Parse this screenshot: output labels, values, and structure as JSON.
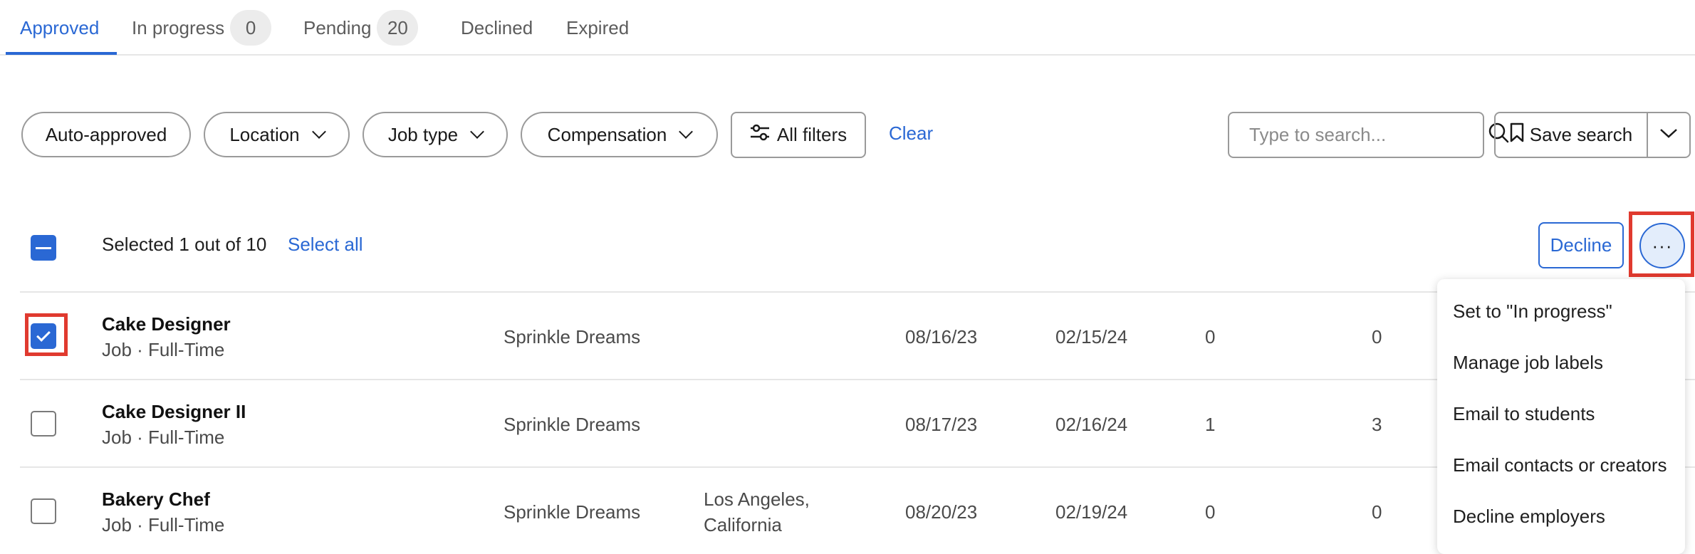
{
  "tabs": [
    {
      "label": "Approved"
    },
    {
      "label": "In progress",
      "count": "0"
    },
    {
      "label": "Pending",
      "count": "20"
    },
    {
      "label": "Declined"
    },
    {
      "label": "Expired"
    }
  ],
  "filters": {
    "auto_approved": "Auto-approved",
    "location": "Location",
    "job_type": "Job type",
    "compensation": "Compensation",
    "all_filters": "All filters",
    "clear": "Clear"
  },
  "search": {
    "placeholder": "Type to search..."
  },
  "save_search": {
    "label": "Save search"
  },
  "selection": {
    "text": "Selected 1 out of 10",
    "select_all": "Select all",
    "decline": "Decline",
    "more": "···"
  },
  "rows": [
    {
      "title": "Cake Designer",
      "subtitle": "Job · Full-Time",
      "employer": "Sprinkle Dreams",
      "location": "",
      "date1": "08/16/23",
      "date2": "02/15/24",
      "num1": "0",
      "num2": "0",
      "checked": true
    },
    {
      "title": "Cake Designer II",
      "subtitle": "Job · Full-Time",
      "employer": "Sprinkle Dreams",
      "location": "",
      "date1": "08/17/23",
      "date2": "02/16/24",
      "num1": "1",
      "num2": "3",
      "checked": false
    },
    {
      "title": "Bakery Chef",
      "subtitle": "Job · Full-Time",
      "employer": "Sprinkle Dreams",
      "location_line1": "Los Angeles,",
      "location_line2": "California",
      "date1": "08/20/23",
      "date2": "02/19/24",
      "num1": "0",
      "num2": "0",
      "checked": false
    }
  ],
  "menu": {
    "items": [
      {
        "label": "Set to \"In progress\""
      },
      {
        "label": "Manage job labels"
      },
      {
        "label": "Email to students"
      },
      {
        "label": "Email contacts or creators"
      },
      {
        "label": "Decline employers"
      }
    ]
  },
  "colors": {
    "accent": "#2a68d4",
    "highlight": "#e03a2f"
  },
  "icons": {
    "search": "search-icon",
    "filters": "sliders-icon",
    "bookmark": "bookmark-icon",
    "chevron": "chevron-down-icon"
  }
}
